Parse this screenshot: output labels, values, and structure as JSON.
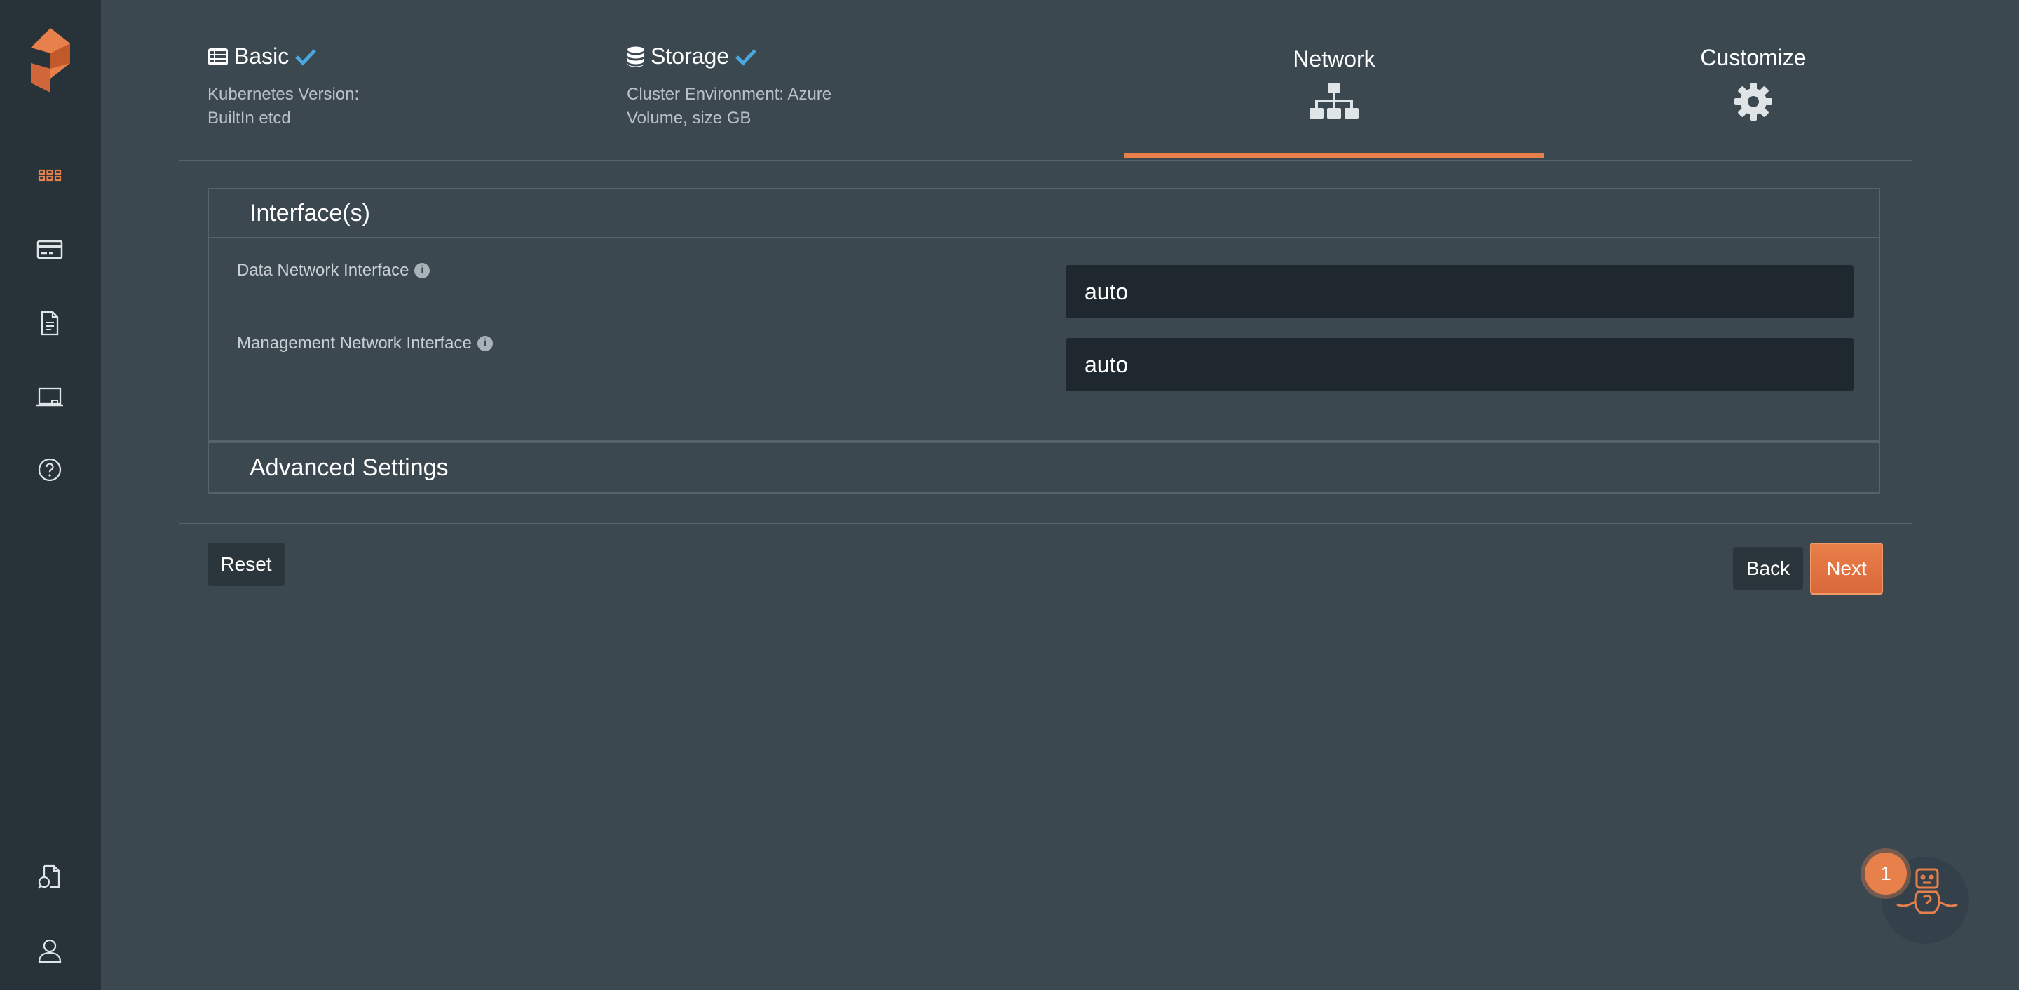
{
  "colors": {
    "accent": "#e8804c",
    "check": "#4aa8e0",
    "background": "#3c4850",
    "sidebar": "#273239",
    "input_bg": "#1f282e"
  },
  "sidebar": {
    "items": [
      {
        "name": "dashboard-grid-icon"
      },
      {
        "name": "card-icon"
      },
      {
        "name": "document-icon"
      },
      {
        "name": "laptop-icon"
      },
      {
        "name": "help-icon"
      },
      {
        "name": "docs-icon"
      },
      {
        "name": "user-icon"
      }
    ]
  },
  "stepper": {
    "steps": [
      {
        "title": "Basic",
        "completed": true,
        "icon": "list-icon",
        "desc1": "Kubernetes Version:",
        "desc2": "BuiltIn etcd"
      },
      {
        "title": "Storage",
        "completed": true,
        "icon": "database-icon",
        "desc1": "Cluster Environment: Azure",
        "desc2": "Volume, size GB"
      },
      {
        "title": "Network",
        "active": true,
        "icon": "sitemap-icon"
      },
      {
        "title": "Customize",
        "icon": "gear-icon"
      }
    ]
  },
  "interfaces": {
    "title": "Interface(s)",
    "fields": [
      {
        "label": "Data Network Interface",
        "value": "auto"
      },
      {
        "label": "Management Network Interface",
        "value": "auto"
      }
    ]
  },
  "advanced": {
    "title": "Advanced Settings"
  },
  "actions": {
    "reset": "Reset",
    "back": "Back",
    "next": "Next"
  },
  "helper": {
    "badge_count": "1"
  }
}
